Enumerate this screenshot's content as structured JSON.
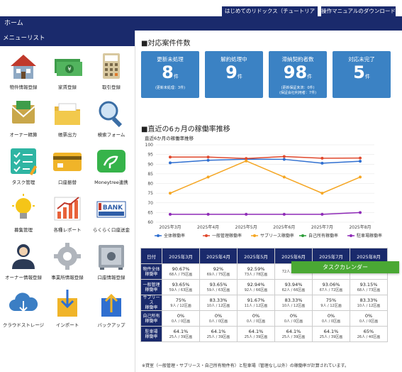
{
  "header": {
    "tutorial_link": "はじめてのリドックス（チュートリアル）",
    "manual_link": "操作マニュアルのダウンロード",
    "nav_home": "ホーム"
  },
  "sidebar": {
    "title": "メニューリスト",
    "items": [
      {
        "label": "物件情報登録",
        "icon": "house-icon"
      },
      {
        "label": "家賃登録",
        "icon": "money-icon"
      },
      {
        "label": "取引登録",
        "icon": "calculator-icon"
      },
      {
        "label": "オーナー精算",
        "icon": "owner-settle-icon"
      },
      {
        "label": "帳票出力",
        "icon": "folder-icon"
      },
      {
        "label": "検索フォーム",
        "icon": "search-icon"
      },
      {
        "label": "タスク管理",
        "icon": "checklist-icon"
      },
      {
        "label": "口座振替",
        "icon": "card-icon"
      },
      {
        "label": "Moneytree連携",
        "icon": "moneytree-icon"
      },
      {
        "label": "募集管理",
        "icon": "bulb-icon"
      },
      {
        "label": "各種レポート",
        "icon": "report-icon"
      },
      {
        "label": "らくらく口座送金",
        "icon": "bank-transfer-icon"
      },
      {
        "label": "オーナー情報登録",
        "icon": "owner-icon"
      },
      {
        "label": "事業所情報登録",
        "icon": "gear-icon"
      },
      {
        "label": "口座情報登録",
        "icon": "safe-icon"
      },
      {
        "label": "クラウドストレージ",
        "icon": "cloud-icon"
      },
      {
        "label": "インポート",
        "icon": "import-icon"
      },
      {
        "label": "バックアップ",
        "icon": "backup-icon"
      }
    ]
  },
  "cases": {
    "title": "■対応案件件数",
    "cards": [
      {
        "title": "更新未処理",
        "value": "8",
        "unit": "件",
        "sub1": "(更新未処理：3件)",
        "sub2": ""
      },
      {
        "title": "解約処理中",
        "value": "9",
        "unit": "件",
        "sub1": "",
        "sub2": ""
      },
      {
        "title": "滞納契約者数",
        "value": "98",
        "unit": "件",
        "sub1": "(更新保証未済：0件)",
        "sub2": "(保証会社利用者：7件)"
      },
      {
        "title": "対応未完了",
        "value": "5",
        "unit": "件",
        "sub1": "",
        "sub2": ""
      }
    ]
  },
  "trend": {
    "section_title": "■直近の6ヵ月の稼働率推移"
  },
  "chart_data": {
    "type": "line",
    "title": "直近6か月の稼働率推移",
    "categories": [
      "2025年3月",
      "2025年4月",
      "2025年5月",
      "2025年6月",
      "2025年7月",
      "2025年8月"
    ],
    "ylim": [
      60,
      100
    ],
    "yticks": [
      60,
      65,
      70,
      75,
      80,
      85,
      90,
      95,
      100
    ],
    "grid": true,
    "legend": "bottom",
    "series": [
      {
        "name": "全体稼働率",
        "color": "#2f6fd0",
        "values": [
          90.67,
          92,
          92.59,
          92.5,
          90.5,
          91.5
        ]
      },
      {
        "name": "一般管理稼働率",
        "color": "#e0482c",
        "values": [
          93.65,
          93.65,
          92.94,
          93.94,
          93.06,
          93.15
        ]
      },
      {
        "name": "サブリース稼働率",
        "color": "#f5a623",
        "values": [
          75,
          83.33,
          91.67,
          83.33,
          75,
          83.33
        ]
      },
      {
        "name": "自己所有稼働率",
        "color": "#2e9e3a",
        "values": [
          0,
          0,
          0,
          0,
          0,
          0
        ]
      },
      {
        "name": "駐車場稼働率",
        "color": "#8e2ab7",
        "values": [
          64.1,
          64.1,
          64.1,
          64.1,
          64.1,
          65
        ]
      }
    ]
  },
  "table": {
    "corner": "日付",
    "months": [
      "2025年3月",
      "2025年4月",
      "2025年5月",
      "2025年6月",
      "2025年7月",
      "2025年8月"
    ],
    "rows": [
      {
        "label": "物件全体\n稼働率",
        "cells": [
          [
            "90.67%",
            "68人 / 75区画"
          ],
          [
            "92%",
            "69人 / 75区画"
          ],
          [
            "92.59%",
            "73人 / 78区画"
          ],
          [
            "",
            "72人 / 78区画"
          ],
          [
            "",
            "76人 / 84区画"
          ],
          [
            "",
            "78人 / 85区画"
          ]
        ]
      },
      {
        "label": "一般管理\n稼働率",
        "cells": [
          [
            "93.65%",
            "59人 / 63区画"
          ],
          [
            "93.65%",
            "59人 / 63区画"
          ],
          [
            "92.94%",
            "92人 / 66区画"
          ],
          [
            "93.94%",
            "62人 / 66区画"
          ],
          [
            "93.06%",
            "67人 / 72区画"
          ],
          [
            "93.15%",
            "68人 / 73区画"
          ]
        ]
      },
      {
        "label": "サブリース\n稼働率",
        "cells": [
          [
            "75%",
            "9人 / 12区画"
          ],
          [
            "83.33%",
            "10人 / 12区画"
          ],
          [
            "91.67%",
            "11人 / 12区画"
          ],
          [
            "83.33%",
            "10人 / 12区画"
          ],
          [
            "75%",
            "9人 / 12区画"
          ],
          [
            "83.33%",
            "10人 / 12区画"
          ]
        ]
      },
      {
        "label": "自己所有\n稼働率",
        "cells": [
          [
            "0%",
            "0人 / 0区画"
          ],
          [
            "0%",
            "0人 / 0区画"
          ],
          [
            "0%",
            "0人 / 0区画"
          ],
          [
            "0%",
            "0人 / 0区画"
          ],
          [
            "0%",
            "0人 / 0区画"
          ],
          [
            "0%",
            "0人 / 0区画"
          ]
        ]
      },
      {
        "label": "駐車場\n稼働率",
        "cells": [
          [
            "64.1%",
            "25人 / 39区画"
          ],
          [
            "64.1%",
            "25人 / 39区画"
          ],
          [
            "64.1%",
            "25人 / 39区画"
          ],
          [
            "64.1%",
            "25人 / 39区画"
          ],
          [
            "64.1%",
            "25人 / 39区画"
          ],
          [
            "65%",
            "26人 / 40区画"
          ]
        ]
      }
    ],
    "task_calendar": "タスクカレンダー",
    "note": "※貸室（一般管理・サブリース・自己所有物件有）と駐車場（管理なし以外）の稼働率が計算されています。"
  }
}
